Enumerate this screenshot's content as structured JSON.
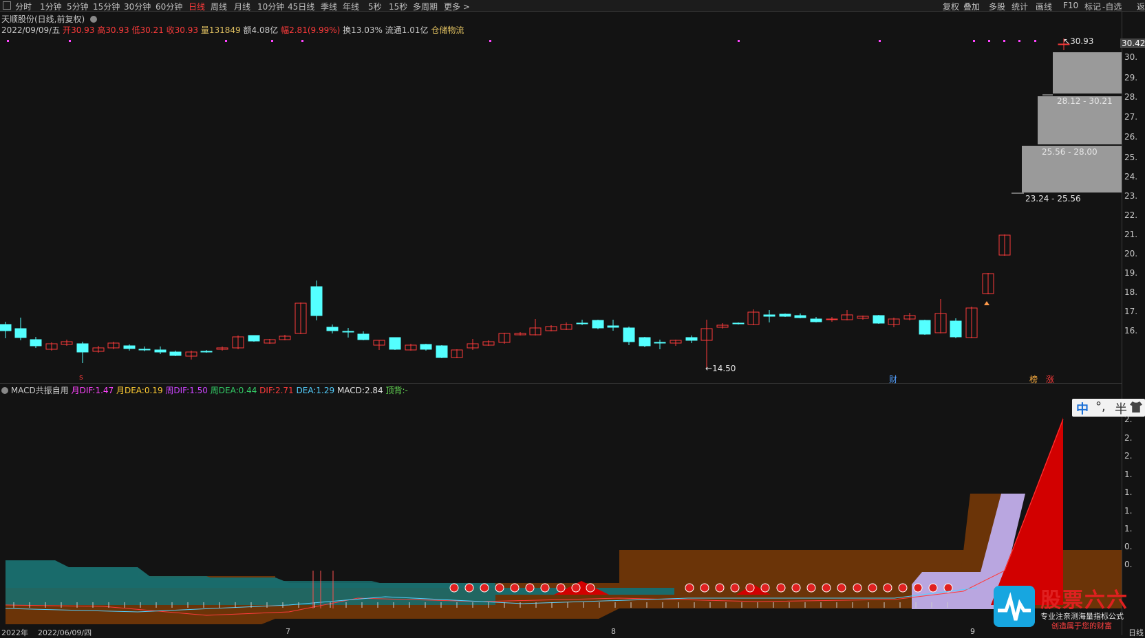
{
  "toolbar": {
    "menu_icon": "menu-icon",
    "periods": [
      "分时",
      "1分钟",
      "5分钟",
      "15分钟",
      "30分钟",
      "60分钟",
      "日线",
      "周线",
      "月线",
      "10分钟",
      "45日线",
      "季线",
      "年线",
      "5秒",
      "15秒",
      "多周期",
      "更多 >"
    ],
    "active_period": "日线",
    "tools": [
      "复权",
      "叠加",
      "多股",
      "统计",
      "画线",
      "F10",
      "标记",
      "-自选",
      "返"
    ]
  },
  "stock": {
    "title": "天顺股份(日线,前复权)",
    "date": "2022/09/09/五",
    "open_label": "开",
    "open": "30.93",
    "high_label": "高",
    "high": "30.93",
    "low_label": "低",
    "low": "30.21",
    "close_label": "收",
    "close": "30.93",
    "volume_label": "量",
    "volume": "131849",
    "amount_label": "额",
    "amount": "4.08亿",
    "change_label": "幅",
    "change": "2.81(9.99%)",
    "turnover_label": "换",
    "turnover": "13.03%",
    "float_label": "流通",
    "float": "1.01亿",
    "sector": "仓储物流"
  },
  "price_axis": [
    "30.42",
    "30.",
    "29.",
    "28.",
    "27.",
    "26.",
    "25.",
    "24.",
    "23.",
    "22.",
    "21.",
    "20.",
    "19.",
    "18.",
    "17.",
    "16."
  ],
  "chips": [
    {
      "label": ""
    },
    {
      "label": "28.12 - 30.21"
    },
    {
      "label": "25.56 - 28.00"
    },
    {
      "label": "23.24 - 25.56"
    }
  ],
  "annotations": {
    "high_marker": "30.93",
    "low_marker": "14.50",
    "tag_cai": "财",
    "tag_bang": "榜",
    "tag_zhang": "涨",
    "tag_s": "s"
  },
  "macd": {
    "name": "MACD共振自用",
    "m_dif_label": "月DIF:",
    "m_dif": "1.47",
    "m_dea_label": "月DEA:",
    "m_dea": "0.19",
    "w_dif_label": "周DIF:",
    "w_dif": "1.50",
    "w_dea_label": "周DEA:",
    "w_dea": "0.44",
    "dif_label": "DIF:",
    "dif": "2.71",
    "dea_label": "DEA:",
    "dea": "1.29",
    "macd_label": "MACD:",
    "macd": "2.84",
    "div_label": "顶背:",
    "div": "-"
  },
  "macd_axis": [
    "2.",
    "2.",
    "2.",
    "1.",
    "1.",
    "1.",
    "1.",
    "0.",
    "0."
  ],
  "bottom_axis": [
    "2022年",
    "2022/06/09/四",
    "7",
    "8",
    "9",
    "日线"
  ],
  "ime": {
    "lang": "中",
    "punct": "°,",
    "width": "半"
  },
  "watermark": {
    "brand": "股票六六",
    "slogan1": "专业注亲测海量指标公式",
    "slogan2": "创造属于您的财富"
  },
  "colors": {
    "up": "#ff3b3b",
    "down": "#54ffff",
    "magenta": "#ff44ff",
    "teal_band": "#1a6b6b",
    "brown_band": "#6b3408",
    "red_area": "#d20000",
    "lavender": "#b9a6e0"
  }
}
